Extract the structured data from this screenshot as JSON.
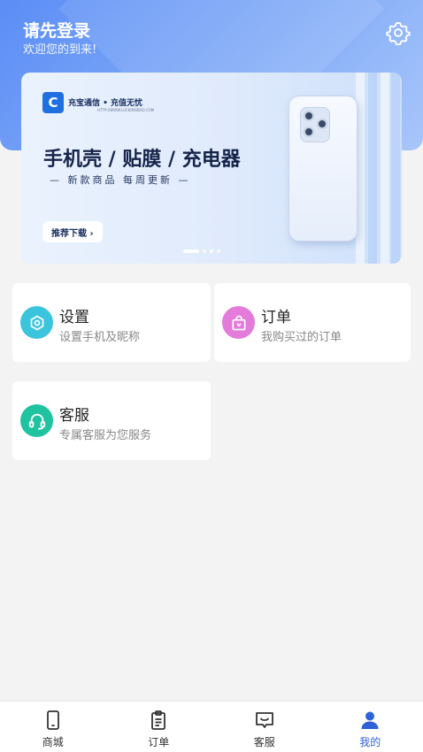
{
  "header": {
    "title": "请先登录",
    "subtitle": "欢迎您的到来!",
    "settings_icon": "gear-icon"
  },
  "banner": {
    "brand": "充宝通信 • 充值无忧",
    "brand_sub": "HTTP://WWW.LUCKIMGBAO.COM",
    "logo_letter": "C",
    "headline": "手机壳 / 贴膜 / 充电器",
    "subline": "— 新款商品  每周更新 —",
    "cta": "推荐下载 ›",
    "page_count": 4,
    "active_page": 1
  },
  "cards": [
    {
      "title": "设置",
      "desc": "设置手机及昵称",
      "icon": "gear-icon",
      "color": "#3bc5dd"
    },
    {
      "title": "订单",
      "desc": "我购买过的订单",
      "icon": "shopping-bag-icon",
      "color": "#e47ad9"
    },
    {
      "title": "客服",
      "desc": "专属客服为您服务",
      "icon": "customer-service-icon",
      "color": "#1fc3a0"
    }
  ],
  "tabbar": {
    "items": [
      {
        "label": "商城",
        "icon": "phone-icon",
        "active": false
      },
      {
        "label": "订单",
        "icon": "clipboard-icon",
        "active": false
      },
      {
        "label": "客服",
        "icon": "chat-icon",
        "active": false
      },
      {
        "label": "我的",
        "icon": "user-icon",
        "active": true
      }
    ],
    "active_color": "#2f62d6"
  }
}
